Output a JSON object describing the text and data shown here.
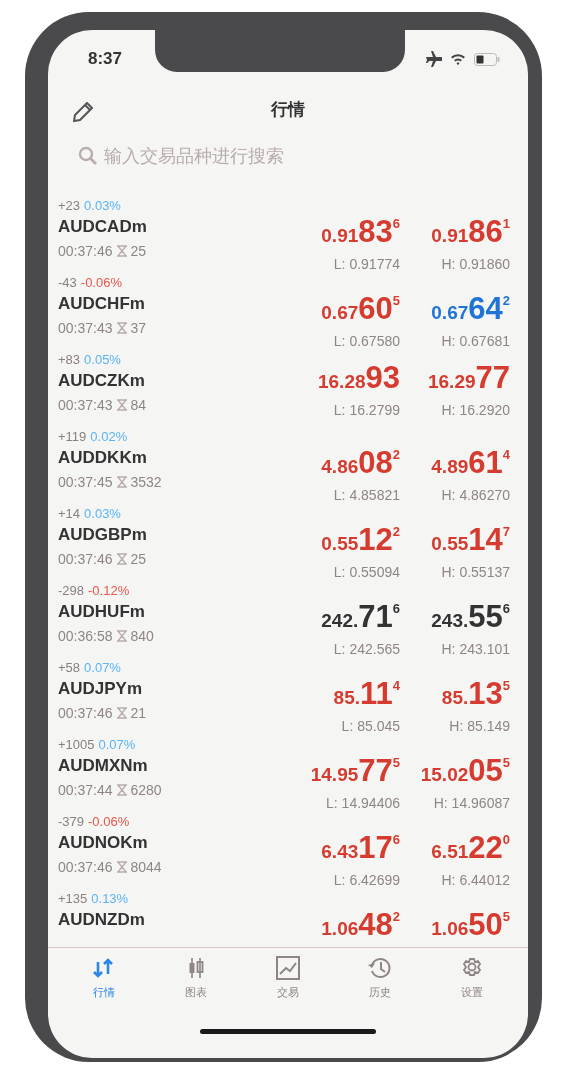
{
  "status_bar": {
    "time": "8:37"
  },
  "header": {
    "title": "行情"
  },
  "search": {
    "placeholder": "输入交易品种进行搜索"
  },
  "quotes": [
    {
      "change": "+23",
      "percent": {
        "text": "0.03%",
        "color": "#5ab4f5"
      },
      "symbol": "AUDCADm",
      "time": "00:37:46",
      "spread": "25",
      "bid": {
        "prefix": "0.91",
        "big": "83",
        "sup": "6",
        "color": "#d63b30"
      },
      "ask": {
        "prefix": "0.91",
        "big": "86",
        "sup": "1",
        "color": "#d63b30"
      },
      "low": "L: 0.91774",
      "high": "H: 0.91860"
    },
    {
      "change": "-43",
      "percent": {
        "text": "-0.06%",
        "color": "#e8564c"
      },
      "symbol": "AUDCHFm",
      "time": "00:37:43",
      "spread": "37",
      "bid": {
        "prefix": "0.67",
        "big": "60",
        "sup": "5",
        "color": "#d63b30"
      },
      "ask": {
        "prefix": "0.67",
        "big": "64",
        "sup": "2",
        "color": "#1f74d6"
      },
      "low": "L: 0.67580",
      "high": "H: 0.67681"
    },
    {
      "change": "+83",
      "percent": {
        "text": "0.05%",
        "color": "#5ab4f5"
      },
      "symbol": "AUDCZKm",
      "time": "00:37:43",
      "spread": "84",
      "bid": {
        "prefix": "16.28",
        "big": "93",
        "color": "#d63b30"
      },
      "ask": {
        "prefix": "16.29",
        "big": "77",
        "color": "#d63b30"
      },
      "low": "L: 16.2799",
      "high": "H: 16.2920"
    },
    {
      "change": "+119",
      "percent": {
        "text": "0.02%",
        "color": "#5ab4f5"
      },
      "symbol": "AUDDKKm",
      "time": "00:37:45",
      "spread": "3532",
      "bid": {
        "prefix": "4.86",
        "big": "08",
        "sup": "2",
        "color": "#d63b30"
      },
      "ask": {
        "prefix": "4.89",
        "big": "61",
        "sup": "4",
        "color": "#d63b30"
      },
      "low": "L: 4.85821",
      "high": "H: 4.86270"
    },
    {
      "change": "+14",
      "percent": {
        "text": "0.03%",
        "color": "#5ab4f5"
      },
      "symbol": "AUDGBPm",
      "time": "00:37:46",
      "spread": "25",
      "bid": {
        "prefix": "0.55",
        "big": "12",
        "sup": "2",
        "color": "#d63b30"
      },
      "ask": {
        "prefix": "0.55",
        "big": "14",
        "sup": "7",
        "color": "#d63b30"
      },
      "low": "L: 0.55094",
      "high": "H: 0.55137"
    },
    {
      "change": "-298",
      "percent": {
        "text": "-0.12%",
        "color": "#e8564c"
      },
      "symbol": "AUDHUFm",
      "time": "00:36:58",
      "spread": "840",
      "bid": {
        "prefix": "242.",
        "big": "71",
        "sup": "6",
        "color": "#333333"
      },
      "ask": {
        "prefix": "243.",
        "big": "55",
        "sup": "6",
        "color": "#333333"
      },
      "low": "L: 242.565",
      "high": "H: 243.101"
    },
    {
      "change": "+58",
      "percent": {
        "text": "0.07%",
        "color": "#5ab4f5"
      },
      "symbol": "AUDJPYm",
      "time": "00:37:46",
      "spread": "21",
      "bid": {
        "prefix": "85.",
        "big": "11",
        "sup": "4",
        "color": "#d63b30"
      },
      "ask": {
        "prefix": "85.",
        "big": "13",
        "sup": "5",
        "color": "#d63b30"
      },
      "low": "L: 85.045",
      "high": "H: 85.149"
    },
    {
      "change": "+1005",
      "percent": {
        "text": "0.07%",
        "color": "#5ab4f5"
      },
      "symbol": "AUDMXNm",
      "time": "00:37:44",
      "spread": "6280",
      "bid": {
        "prefix": "14.95",
        "big": "77",
        "sup": "5",
        "color": "#d63b30"
      },
      "ask": {
        "prefix": "15.02",
        "big": "05",
        "sup": "5",
        "color": "#d63b30"
      },
      "low": "L: 14.94406",
      "high": "H: 14.96087"
    },
    {
      "change": "-379",
      "percent": {
        "text": "-0.06%",
        "color": "#e8564c"
      },
      "symbol": "AUDNOKm",
      "time": "00:37:46",
      "spread": "8044",
      "bid": {
        "prefix": "6.43",
        "big": "17",
        "sup": "6",
        "color": "#d63b30"
      },
      "ask": {
        "prefix": "6.51",
        "big": "22",
        "sup": "0",
        "color": "#d63b30"
      },
      "low": "L: 6.42699",
      "high": "H: 6.44012"
    },
    {
      "change": "+135",
      "percent": {
        "text": "0.13%",
        "color": "#5ab4f5"
      },
      "symbol": "AUDNZDm",
      "bid": {
        "prefix": "1.06",
        "big": "48",
        "sup": "2",
        "color": "#d63b30"
      },
      "ask": {
        "prefix": "1.06",
        "big": "50",
        "sup": "5",
        "color": "#d63b30"
      }
    }
  ],
  "tabs": [
    {
      "label": "行情",
      "selected": true
    },
    {
      "label": "图表",
      "selected": false
    },
    {
      "label": "交易",
      "selected": false
    },
    {
      "label": "历史",
      "selected": false
    },
    {
      "label": "设置",
      "selected": false
    }
  ]
}
